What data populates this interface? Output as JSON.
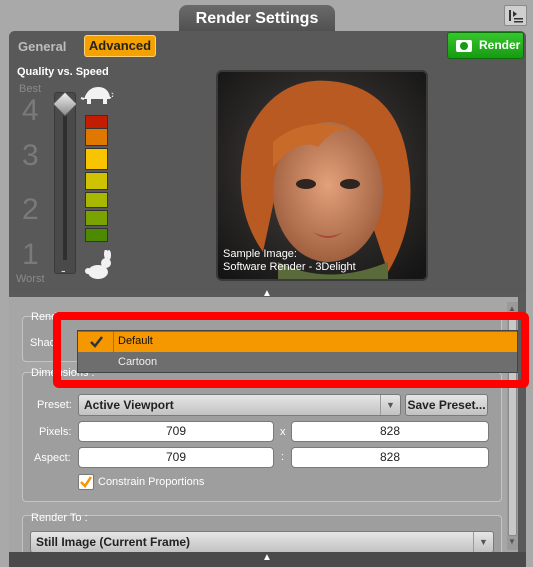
{
  "window": {
    "title": "Render Settings"
  },
  "tabs": {
    "general": "General",
    "advanced": "Advanced"
  },
  "render_button": "Render",
  "quality": {
    "label": "Quality vs. Speed",
    "best": "Best",
    "worst": "Worst",
    "levels": [
      "4",
      "3",
      "2",
      "1"
    ],
    "selected_level": 4,
    "level_colors": [
      "#c21d00",
      "#e07800",
      "#f8c400",
      "#cfc200",
      "#a8b800",
      "#7aa200",
      "#4e8a00"
    ]
  },
  "preview": {
    "caption_line1": "Sample Image:",
    "caption_line2": "Software Render - 3Delight"
  },
  "render_engine": {
    "group_title": "Rend",
    "shader_label": "Shad"
  },
  "shader_dropdown": {
    "options": [
      "Default",
      "Cartoon"
    ],
    "selected": "Default",
    "highlight_color": "#ff0000"
  },
  "dimensions": {
    "group_title": "Dimensions :",
    "preset_label": "Preset:",
    "preset_value": "Active Viewport",
    "save_preset": "Save Preset...",
    "pixels_label": "Pixels:",
    "pixels_width": "709",
    "pixels_separator": "x",
    "pixels_height": "828",
    "aspect_label": "Aspect:",
    "aspect_width": "709",
    "aspect_separator": ":",
    "aspect_height": "828",
    "constrain_label": "Constrain Proportions",
    "constrain_checked": true
  },
  "render_to": {
    "group_title": "Render To :",
    "value": "Still Image (Current Frame)"
  },
  "colors": {
    "accent": "#f59800",
    "render_green": "#1fae18"
  }
}
